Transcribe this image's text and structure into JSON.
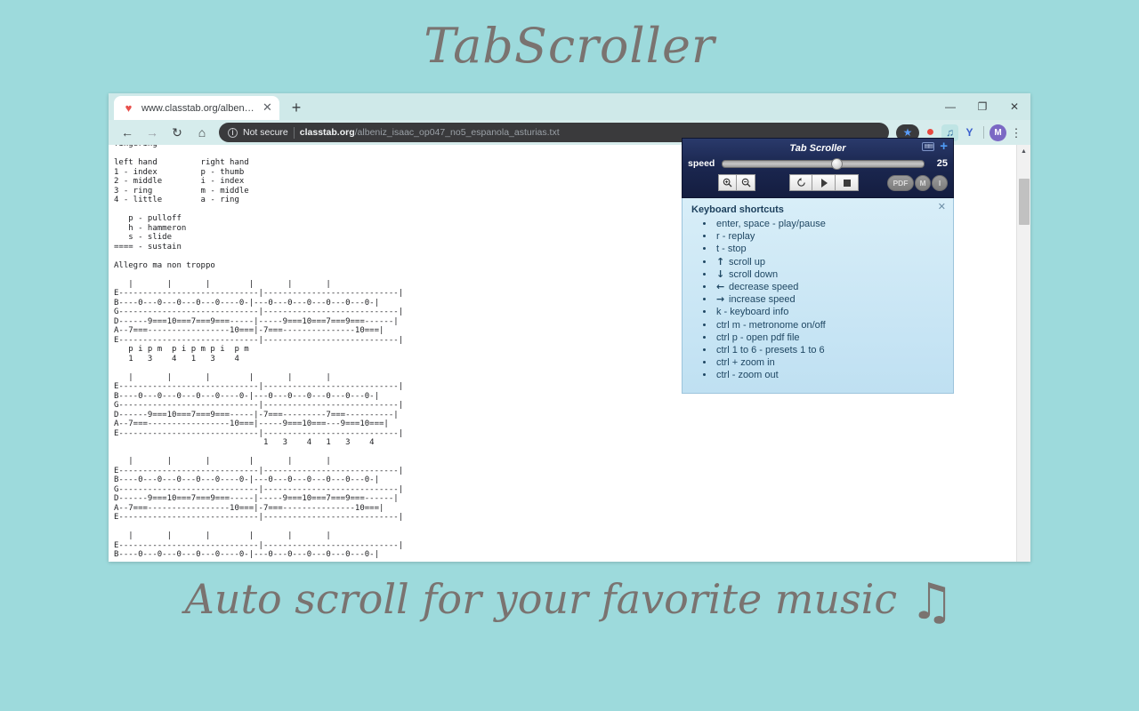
{
  "promo": {
    "title": "TabScroller",
    "tagline": "Auto scroll for your favorite music",
    "note_glyph": "♫"
  },
  "browser": {
    "tab": {
      "favicon": "heart-icon",
      "favicon_glyph": "♥",
      "title": "www.classtab.org/albeniz_isaac_o",
      "close_glyph": "✕"
    },
    "newtab_glyph": "+",
    "window_controls": {
      "minimize": "—",
      "restore": "❐",
      "close": "✕"
    },
    "toolbar": {
      "back_glyph": "←",
      "forward_glyph": "→",
      "reload_glyph": "↻",
      "home_glyph": "⌂",
      "security_info_glyph": "i",
      "security_label": "Not secure",
      "url_domain": "classtab.org",
      "url_path": "/albeniz_isaac_op047_no5_espanola_asturias.txt",
      "star_glyph": "★",
      "ext_opera_glyph": "●",
      "ext_music_glyph": "♫",
      "ext_y_glyph": "Y",
      "avatar_label": "M",
      "menu_glyph": "⋮"
    },
    "scrollbar": {
      "up_arrow": "▲"
    }
  },
  "page": {
    "text": "fingering -\n\nleft hand         right hand\n1 - index         p - thumb\n2 - middle        i - index\n3 - ring          m - middle\n4 - little        a - ring\n\n   p - pulloff\n   h - hammeron\n   s - slide\n==== - sustain\n\nAllegro ma non troppo\n\n   |       |       |        |       |       |\nE-----------------------------|----------------------------|\nB----0---0---0---0---0----0-|---0---0---0---0---0---0-|\nG-----------------------------|----------------------------|\nD------9===10===7===9===-----|-----9===10===7===9===------|\nA--7===-----------------10===|-7===---------------10===|\nE-----------------------------|----------------------------|\n   p i p m  p i p m p i  p m\n   1   3    4   1   3    4\n\n   |       |       |        |       |       |\nE-----------------------------|----------------------------|\nB----0---0---0---0---0----0-|---0---0---0---0---0---0-|\nG-----------------------------|----------------------------|\nD------9===10===7===9===-----|-7===---------7===----------|\nA--7===-----------------10===|-----9===10===---9===10===|\nE-----------------------------|----------------------------|\n                               1   3    4   1   3    4\n\n   |       |       |        |       |       |\nE-----------------------------|----------------------------|\nB----0---0---0---0---0----0-|---0---0---0---0---0---0-|\nG-----------------------------|----------------------------|\nD------9===10===7===9===-----|-----9===10===7===9===------|\nA--7===-----------------10===|-7===---------------10===|\nE-----------------------------|----------------------------|\n\n   |       |       |        |       |       |\nE-----------------------------|----------------------------|\nB----0---0---0---0---0----0-|---0---0---0---0---0---0-|"
  },
  "tabscroller": {
    "title": "Tab Scroller",
    "keyboard_icon": "keyboard-icon",
    "expand_glyph": "+",
    "speed_label": "speed",
    "speed_value": "25",
    "speed_percent": 54,
    "buttons": {
      "zoom_in": "⌕",
      "zoom_out": "⌕",
      "replay": "↻",
      "play": "play-triangle",
      "stop": "stop-square",
      "pdf": "PDF",
      "metronome": "M",
      "info": "I"
    },
    "shortcuts": {
      "title": "Keyboard shortcuts",
      "close_glyph": "✕",
      "items": [
        {
          "icon": "",
          "text": "enter, space - play/pause"
        },
        {
          "icon": "",
          "text": "r - replay"
        },
        {
          "icon": "",
          "text": "t - stop"
        },
        {
          "icon": "↑",
          "text": "scroll up"
        },
        {
          "icon": "↓",
          "text": "scroll down"
        },
        {
          "icon": "←",
          "text": "decrease speed"
        },
        {
          "icon": "→",
          "text": "increase speed"
        },
        {
          "icon": "",
          "text": "k - keyboard info"
        },
        {
          "icon": "",
          "text": "ctrl m - metronome on/off"
        },
        {
          "icon": "",
          "text": "ctrl p - open pdf file"
        },
        {
          "icon": "",
          "text": "ctrl 1 to 6 - presets 1 to 6"
        },
        {
          "icon": "",
          "text": "ctrl + zoom in"
        },
        {
          "icon": "",
          "text": "ctrl - zoom out"
        }
      ]
    }
  }
}
